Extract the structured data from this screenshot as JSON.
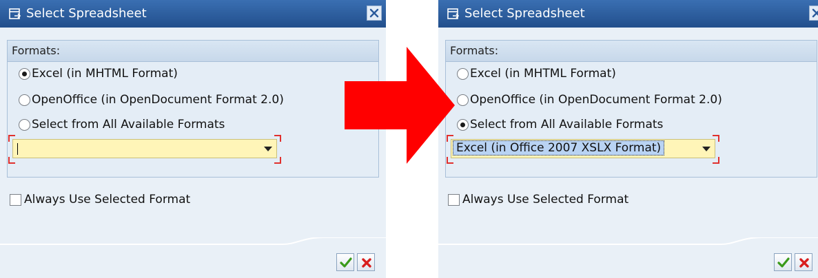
{
  "left_dialog": {
    "title": "Select Spreadsheet",
    "group_title": "Formats:",
    "options": [
      {
        "label": "Excel (in MHTML Format)",
        "checked": true
      },
      {
        "label": "OpenOffice (in OpenDocument Format 2.0)",
        "checked": false
      },
      {
        "label": "Select from All Available Formats",
        "checked": false
      }
    ],
    "format_select_value": "",
    "always_use_label": "Always Use Selected Format",
    "always_use_checked": false
  },
  "right_dialog": {
    "title": "Select Spreadsheet",
    "group_title": "Formats:",
    "options": [
      {
        "label": "Excel (in MHTML Format)",
        "checked": false
      },
      {
        "label": "OpenOffice (in OpenDocument Format 2.0)",
        "checked": false
      },
      {
        "label": "Select from All Available Formats",
        "checked": true
      }
    ],
    "format_select_value": "Excel (in Office 2007 XSLX Format)",
    "always_use_label": "Always Use Selected Format",
    "always_use_checked": false
  },
  "icons": {
    "title": "dialog-icon",
    "close": "close-icon",
    "confirm": "checkmark-icon",
    "cancel": "cancel-icon",
    "dropdown": "chevron-down-icon",
    "transition": "right-arrow-icon"
  },
  "colors": {
    "title_bar": "#2c5d9e",
    "field_bg": "#fff5b8",
    "arrow": "#ff0000",
    "required_marker": "#e0302d",
    "ok_check": "#3a9a1a",
    "cancel_x": "#d81e1e"
  }
}
